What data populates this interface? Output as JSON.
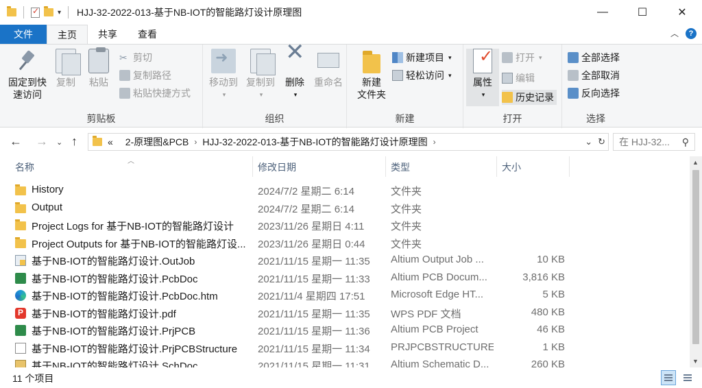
{
  "window": {
    "title": "HJJ-32-2022-013-基于NB-IOT的智能路灯设计原理图",
    "minimize": "—",
    "maximize": "☐",
    "close": "✕"
  },
  "tabs": {
    "file": "文件",
    "home": "主页",
    "share": "共享",
    "view": "查看",
    "help": "?"
  },
  "ribbon": {
    "clipboard": {
      "label": "剪贴板",
      "pin": "固定到快\n速访问",
      "pin_l1": "固定到快",
      "pin_l2": "速访问",
      "copy": "复制",
      "paste": "粘贴",
      "cut": "剪切",
      "copy_path": "复制路径",
      "paste_shortcut": "粘贴快捷方式"
    },
    "organize": {
      "label": "组织",
      "move_to": "移动到",
      "copy_to": "复制到",
      "delete": "删除",
      "rename": "重命名"
    },
    "new": {
      "label": "新建",
      "new_folder_l1": "新建",
      "new_folder_l2": "文件夹",
      "new_item": "新建项目",
      "easy_access": "轻松访问"
    },
    "open": {
      "label": "打开",
      "properties": "属性",
      "open": "打开",
      "edit": "编辑",
      "history": "历史记录"
    },
    "select": {
      "label": "选择",
      "select_all": "全部选择",
      "select_none": "全部取消",
      "invert": "反向选择"
    }
  },
  "address": {
    "prefix": "«",
    "crumbs": [
      "2-原理图&PCB",
      "HJJ-32-2022-013-基于NB-IOT的智能路灯设计原理图"
    ],
    "search_placeholder": "在 HJJ-32..."
  },
  "columns": {
    "name": "名称",
    "date": "修改日期",
    "type": "类型",
    "size": "大小"
  },
  "files": [
    {
      "icon": "folder",
      "name": "History",
      "date": "2024/7/2 星期二 6:14",
      "type": "文件夹",
      "size": ""
    },
    {
      "icon": "folder",
      "name": "Output",
      "date": "2024/7/2 星期二 6:14",
      "type": "文件夹",
      "size": ""
    },
    {
      "icon": "folder",
      "name": "Project Logs for 基于NB-IOT的智能路灯设计",
      "date": "2023/11/26 星期日 4:11",
      "type": "文件夹",
      "size": ""
    },
    {
      "icon": "folder",
      "name": "Project Outputs for 基于NB-IOT的智能路灯设...",
      "date": "2023/11/26 星期日 0:44",
      "type": "文件夹",
      "size": ""
    },
    {
      "icon": "outjob",
      "name": "基于NB-IOT的智能路灯设计.OutJob",
      "date": "2021/11/15 星期一 11:35",
      "type": "Altium Output Job ...",
      "size": "10 KB"
    },
    {
      "icon": "pcb",
      "name": "基于NB-IOT的智能路灯设计.PcbDoc",
      "date": "2021/11/15 星期一 11:33",
      "type": "Altium PCB Docum...",
      "size": "3,816 KB"
    },
    {
      "icon": "edge",
      "name": "基于NB-IOT的智能路灯设计.PcbDoc.htm",
      "date": "2021/11/4 星期四 17:51",
      "type": "Microsoft Edge HT...",
      "size": "5 KB"
    },
    {
      "icon": "pdf",
      "name": "基于NB-IOT的智能路灯设计.pdf",
      "date": "2021/11/15 星期一 11:35",
      "type": "WPS PDF 文档",
      "size": "480 KB"
    },
    {
      "icon": "prj",
      "name": "基于NB-IOT的智能路灯设计.PrjPCB",
      "date": "2021/11/15 星期一 11:36",
      "type": "Altium PCB Project",
      "size": "46 KB"
    },
    {
      "icon": "file",
      "name": "基于NB-IOT的智能路灯设计.PrjPCBStructure",
      "date": "2021/11/15 星期一 11:34",
      "type": "PRJPCBSTRUCTURE...",
      "size": "1 KB"
    },
    {
      "icon": "sch",
      "name": "基于NB-IOT的智能路灯设计.SchDoc",
      "date": "2021/11/15 星期一 11:31",
      "type": "Altium Schematic D...",
      "size": "260 KB"
    }
  ],
  "status": {
    "count": "11 个项目"
  },
  "colors": {
    "accent": "#1a73c7",
    "ribbon_bg": "#f5f6f7",
    "folder": "#f2c24b"
  }
}
